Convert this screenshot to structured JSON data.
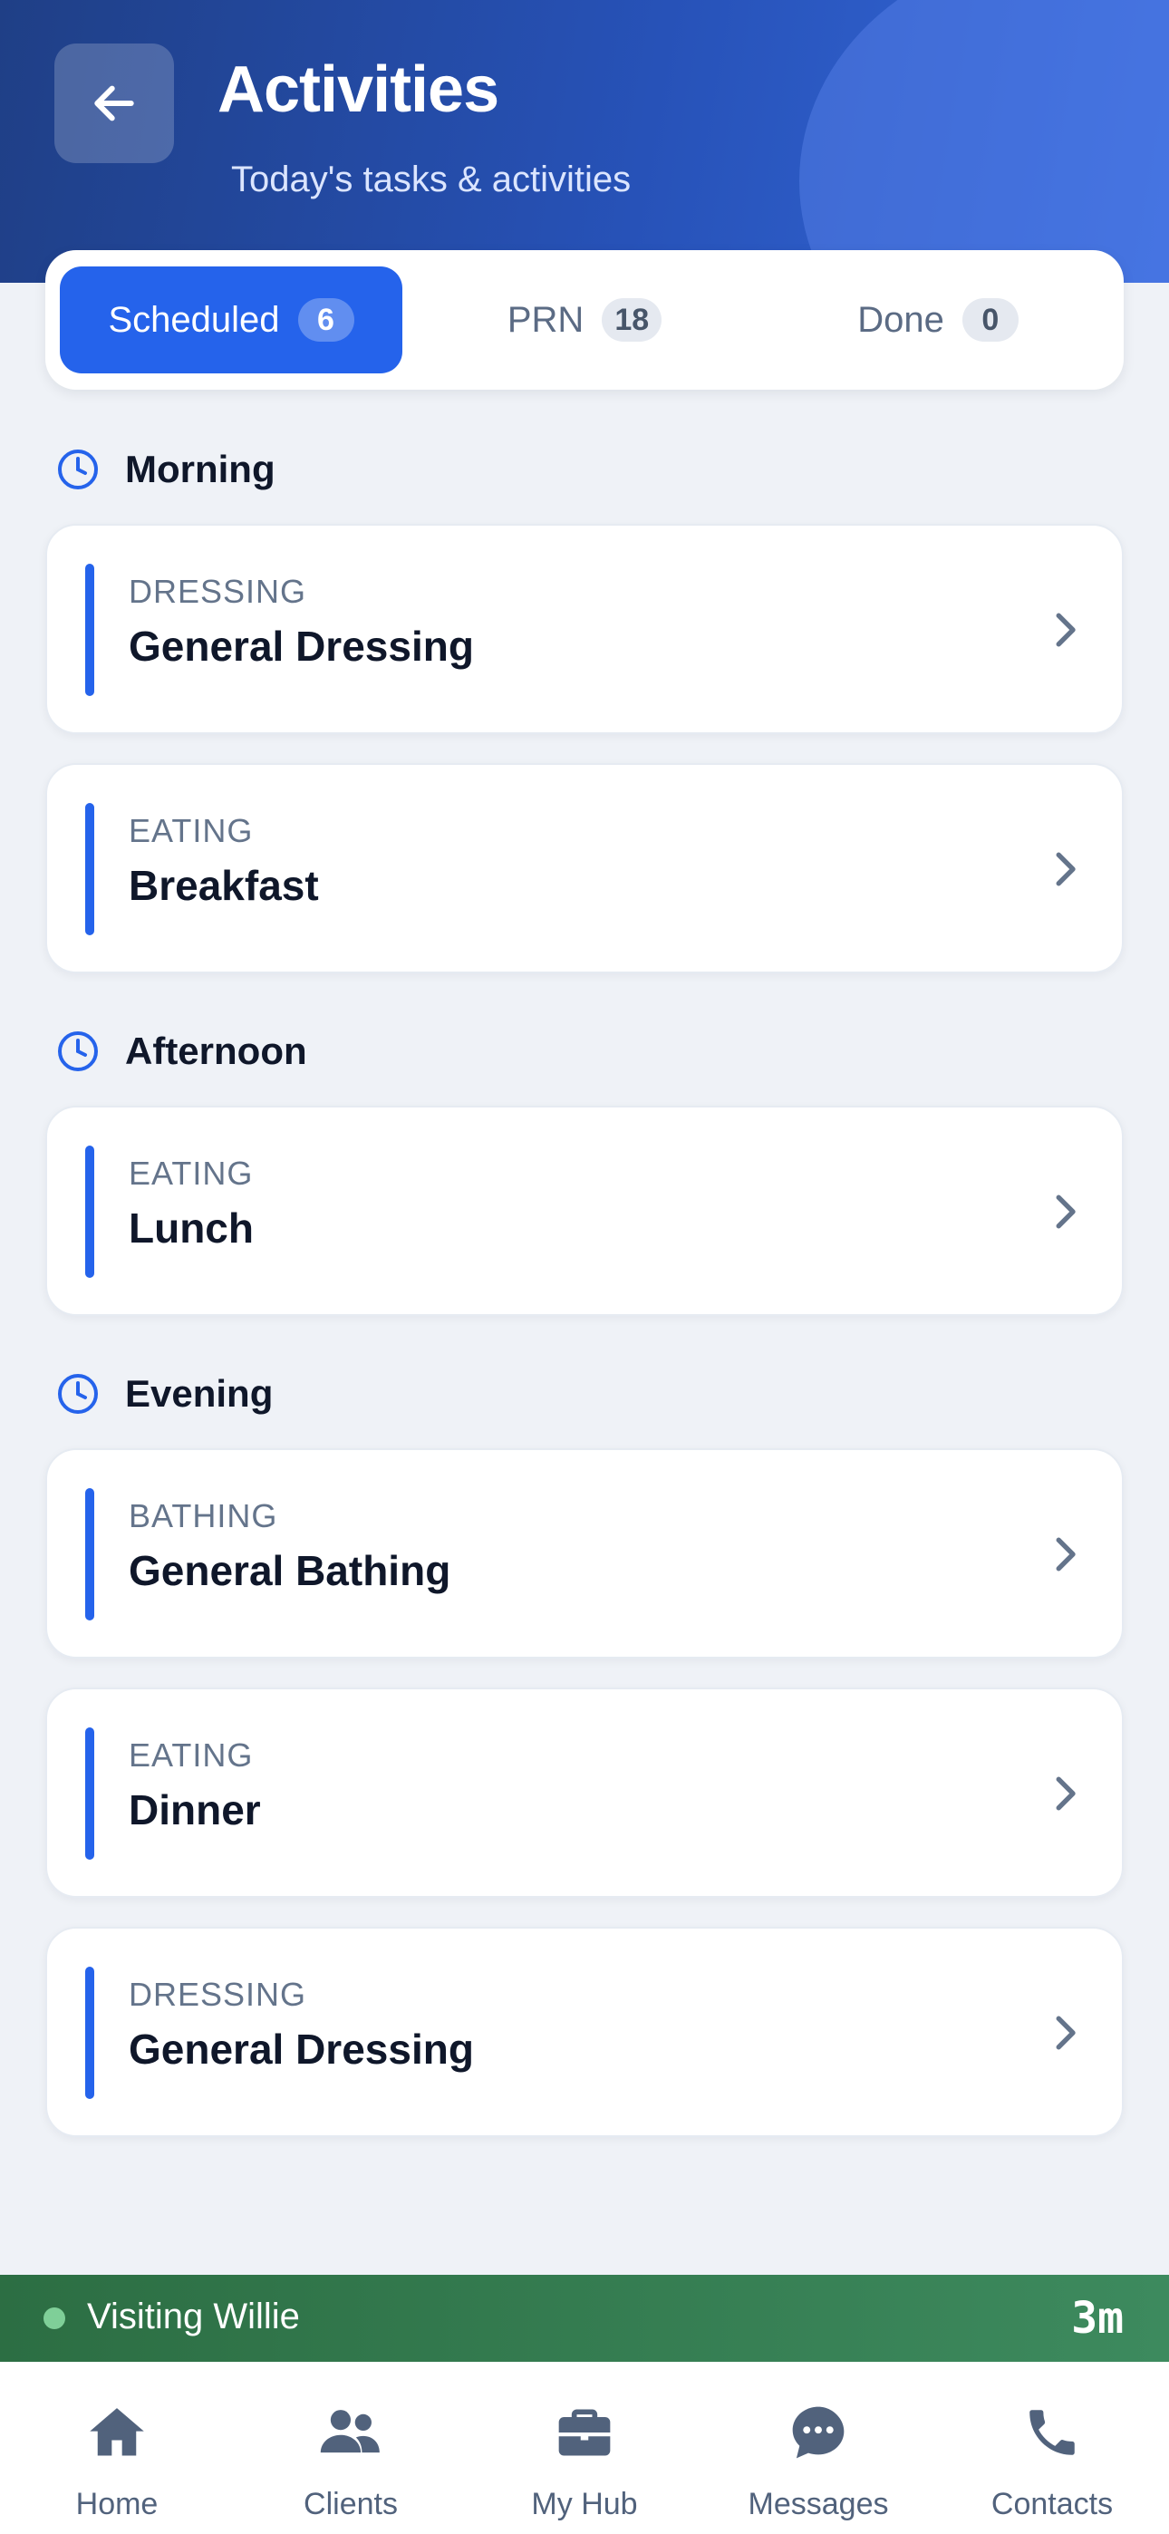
{
  "header": {
    "title": "Activities",
    "subtitle": "Today's tasks & activities",
    "back_icon": "arrow-left-icon"
  },
  "tabs": [
    {
      "label": "Scheduled",
      "count": "6",
      "active": true
    },
    {
      "label": "PRN",
      "count": "18",
      "active": false
    },
    {
      "label": "Done",
      "count": "0",
      "active": false
    }
  ],
  "sections": {
    "morning": {
      "title": "Morning",
      "items": [
        {
          "category": "DRESSING",
          "name": "General Dressing"
        },
        {
          "category": "EATING",
          "name": "Breakfast"
        }
      ]
    },
    "afternoon": {
      "title": "Afternoon",
      "items": [
        {
          "category": "EATING",
          "name": "Lunch"
        }
      ]
    },
    "evening": {
      "title": "Evening",
      "items": [
        {
          "category": "BATHING",
          "name": "General Bathing"
        },
        {
          "category": "EATING",
          "name": "Dinner"
        },
        {
          "category": "DRESSING",
          "name": "General Dressing"
        }
      ]
    }
  },
  "visit": {
    "label": "Visiting Willie",
    "elapsed": "3m"
  },
  "nav": [
    {
      "label": "Home",
      "icon": "home-icon"
    },
    {
      "label": "Clients",
      "icon": "users-icon"
    },
    {
      "label": "My Hub",
      "icon": "briefcase-icon"
    },
    {
      "label": "Messages",
      "icon": "chat-bubble-icon"
    },
    {
      "label": "Contacts",
      "icon": "phone-icon"
    }
  ],
  "colors": {
    "accent": "#2563eb",
    "header_dark": "#1f3f86",
    "visit_green": "#2c6e43"
  }
}
